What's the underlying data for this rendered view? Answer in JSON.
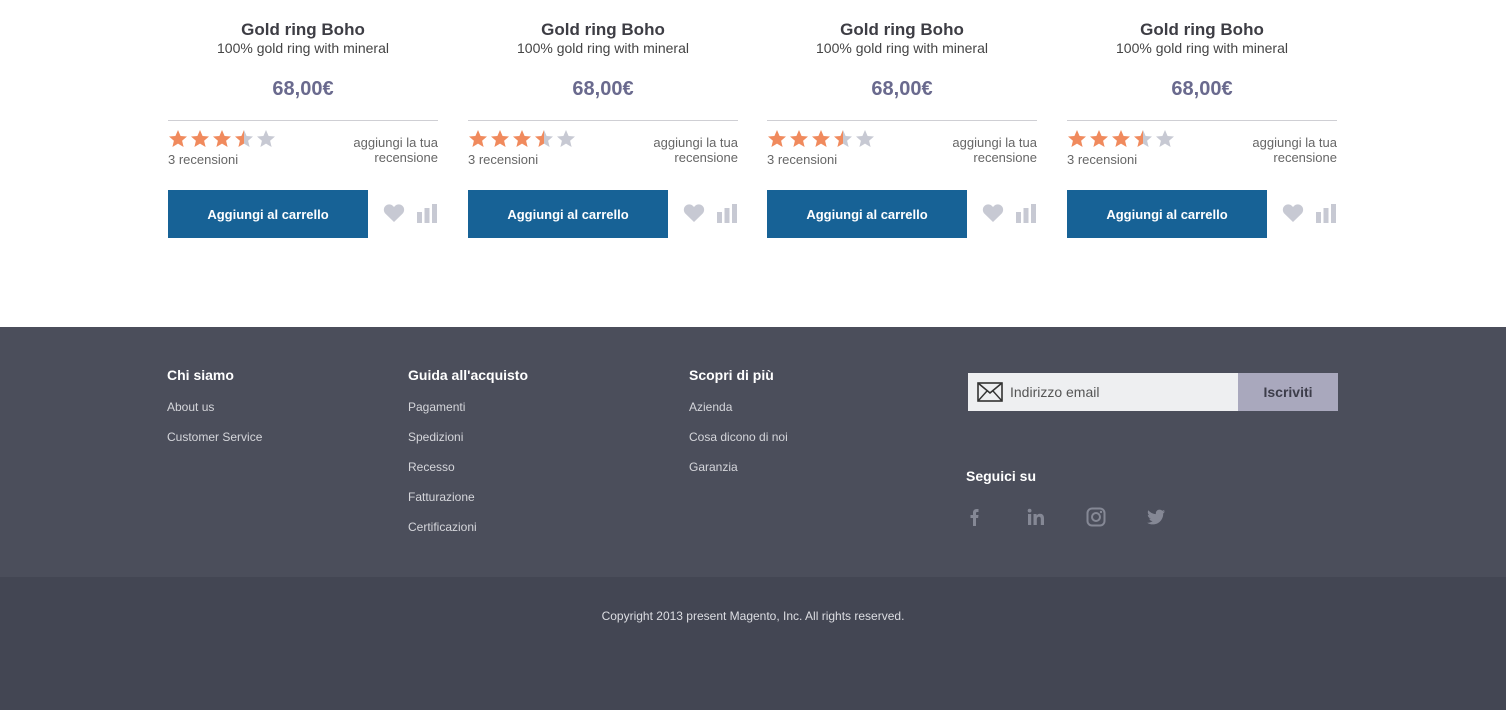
{
  "products": [
    {
      "name": "Gold ring Boho",
      "description": "100% gold ring with mineral",
      "price": "68,00€",
      "rating": 3.5,
      "max_rating": 5,
      "reviews": "3 recensioni",
      "add_review": "aggiungi la tua recensione",
      "cart_label": "Aggiungi al carrello"
    },
    {
      "name": "Gold ring Boho",
      "description": "100% gold ring with mineral",
      "price": "68,00€",
      "rating": 3.5,
      "max_rating": 5,
      "reviews": "3 recensioni",
      "add_review": "aggiungi la tua recensione",
      "cart_label": "Aggiungi al carrello"
    },
    {
      "name": "Gold ring Boho",
      "description": "100% gold ring with mineral",
      "price": "68,00€",
      "rating": 3.5,
      "max_rating": 5,
      "reviews": "3 recensioni",
      "add_review": "aggiungi la tua recensione",
      "cart_label": "Aggiungi al carrello"
    },
    {
      "name": "Gold ring Boho",
      "description": "100% gold ring with mineral",
      "price": "68,00€",
      "rating": 3.5,
      "max_rating": 5,
      "reviews": "3 recensioni",
      "add_review": "aggiungi la tua recensione",
      "cart_label": "Aggiungi al carrello"
    }
  ],
  "footer": {
    "columns": [
      {
        "title": "Chi siamo",
        "links": [
          "About us",
          "Customer Service"
        ]
      },
      {
        "title": "Guida all'acquisto",
        "links": [
          "Pagamenti",
          "Spedizioni",
          "Recesso",
          "Fatturazione",
          "Certificazioni"
        ]
      },
      {
        "title": "Scopri di più",
        "links": [
          "Azienda",
          "Cosa dicono di noi",
          "Garanzia"
        ]
      }
    ],
    "newsletter": {
      "placeholder": "Indirizzo email",
      "button_label": "Iscriviti",
      "icon": "mail-icon"
    },
    "social_title": "Seguici su",
    "social_icons": [
      "facebook-icon",
      "linkedin-icon",
      "instagram-icon",
      "twitter-icon"
    ],
    "copyright": "Copyright 2013 present Magento, Inc. All rights reserved."
  },
  "colors": {
    "star_filled": "#f08a5d",
    "star_empty": "#c7c9d3",
    "button_primary": "#176296",
    "price": "#6a6a8e",
    "footer_bg": "#4b4e5b",
    "footer_bottom_bg": "#434653",
    "subscribe_bg": "#a9a8bd"
  }
}
